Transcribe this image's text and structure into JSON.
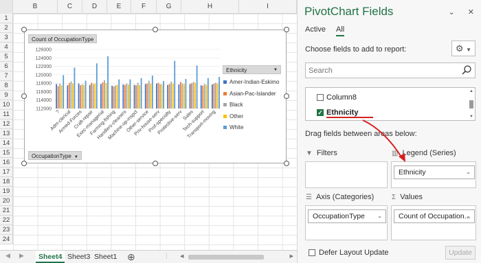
{
  "sheet": {
    "columns": [
      "B",
      "C",
      "D",
      "E",
      "F",
      "G",
      "H",
      "I"
    ],
    "rows": [
      "1",
      "2",
      "3",
      "4",
      "5",
      "6",
      "7",
      "8",
      "9",
      "10",
      "11",
      "12",
      "13",
      "14",
      "15",
      "16",
      "17",
      "18",
      "19",
      "20",
      "21",
      "22",
      "23",
      "24"
    ],
    "tabs": [
      "Sheet4",
      "Sheet3",
      "Sheet1"
    ],
    "active_tab": "Sheet4",
    "add_sheet_icon": "plus-circle-icon"
  },
  "chart": {
    "value_field_button": "Count of OccupationType",
    "axis_field_button": "OccupationType",
    "legend_field_button": "Ethnicity"
  },
  "chart_data": {
    "type": "bar",
    "categories": [
      "?",
      "Adm-clerical",
      "Armed-Forces",
      "Craft-repair",
      "Exec-managerial",
      "Farming-fishing",
      "Handlers-cleaners",
      "Machine-op-inspct",
      "Other-service",
      "Priv-house-serv",
      "Prof-specialty",
      "Protective-serv",
      "Sales",
      "Tech-support",
      "Transport-moving"
    ],
    "series": [
      {
        "name": "Amer-Indian-Eskimo",
        "color": "#4472c4",
        "values": [
          117800,
          117500,
          117900,
          117600,
          117800,
          117400,
          117700,
          117600,
          117800,
          117900,
          117600,
          117700,
          117800,
          117500,
          117700
        ]
      },
      {
        "name": "Asian-Pac-Islander",
        "color": "#ed7d31",
        "values": [
          117300,
          118000,
          117500,
          118100,
          118200,
          117200,
          117600,
          117500,
          117900,
          118100,
          117800,
          118300,
          118000,
          117400,
          117900
        ]
      },
      {
        "name": "Black",
        "color": "#a5a5a5",
        "values": [
          117900,
          118400,
          117700,
          117800,
          118700,
          117500,
          117900,
          118100,
          118600,
          117800,
          118400,
          117900,
          118300,
          117800,
          118100
        ]
      },
      {
        "name": "Other",
        "color": "#ffc000",
        "values": [
          117500,
          117900,
          117600,
          117900,
          118000,
          117600,
          117700,
          117600,
          117900,
          117700,
          117900,
          117800,
          118100,
          117600,
          117900
        ]
      },
      {
        "name": "White",
        "color": "#5b9bd5",
        "values": [
          119900,
          121700,
          118600,
          122700,
          124400,
          118900,
          118900,
          119200,
          119800,
          118500,
          123300,
          119000,
          122200,
          119200,
          119500
        ]
      }
    ],
    "y_ticks": [
      "112000",
      "114000",
      "116000",
      "118000",
      "120000",
      "122000",
      "124000",
      "126000"
    ],
    "ylim": [
      112000,
      126000
    ],
    "legend_position": "right"
  },
  "pane": {
    "title": "PivotChart Fields",
    "tabs": [
      "Active",
      "All"
    ],
    "active_tab": "All",
    "choose_label": "Choose fields to add to report:",
    "search_placeholder": "Search",
    "fields": [
      {
        "label": "Column8",
        "checked": false
      },
      {
        "label": "Ethnicity",
        "checked": true
      }
    ],
    "drag_label": "Drag fields between areas below:",
    "areas": {
      "filters": {
        "label": "Filters",
        "value": ""
      },
      "legend": {
        "label": "Legend (Series)",
        "value": "Ethnicity"
      },
      "axis": {
        "label": "Axis (Categories)",
        "value": "OccupationType"
      },
      "values": {
        "label": "Values",
        "value": "Count of Occupation..."
      }
    },
    "defer_label": "Defer Layout Update",
    "update_label": "Update"
  }
}
